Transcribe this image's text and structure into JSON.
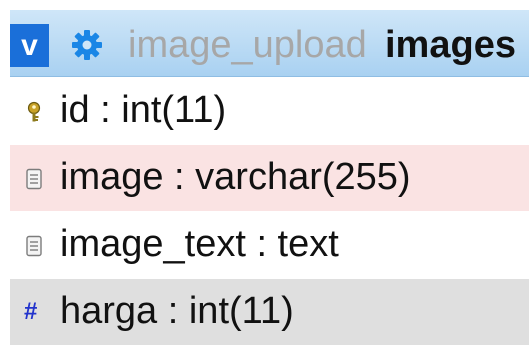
{
  "header": {
    "collapse_label": "v",
    "database": "image_upload",
    "table": "images"
  },
  "columns": [
    {
      "name": "id",
      "type": "int(11)",
      "icon": "key-icon"
    },
    {
      "name": "image",
      "type": "varchar(255)",
      "icon": "text-field-icon"
    },
    {
      "name": "image_text",
      "type": "text",
      "icon": "text-field-icon"
    },
    {
      "name": "harga",
      "type": "int(11)",
      "icon": "hash-icon"
    }
  ],
  "labels": {
    "row0": "id : int(11)",
    "row1": "image : varchar(255)",
    "row2": "image_text : text",
    "row3": "harga : int(11)",
    "hash_glyph": "#"
  },
  "colors": {
    "header_bg": "#a9d1f1",
    "collapse_button": "#1a6fd9",
    "gear": "#1a86e6",
    "highlight_row": "#fae3e3",
    "hover_row": "#dfdfdf"
  }
}
